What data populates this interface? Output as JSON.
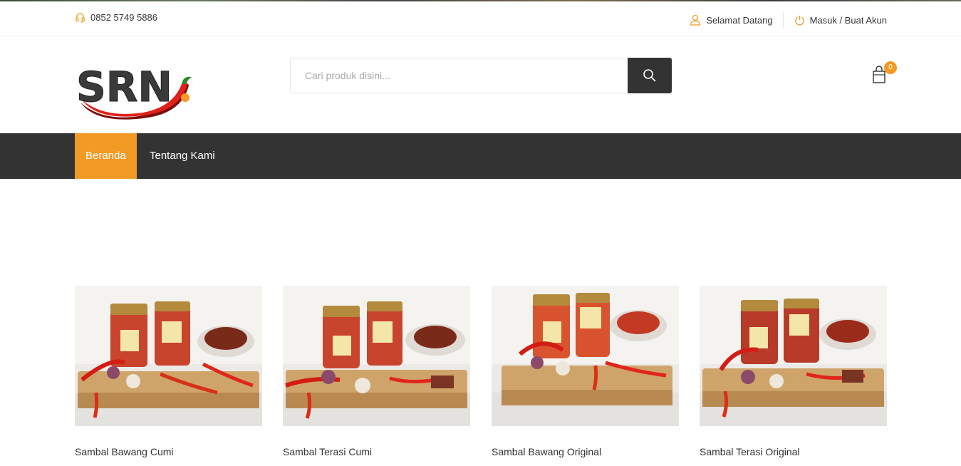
{
  "topbar": {
    "phone": "0852 5749 5886",
    "welcome": "Selamat Datang",
    "login": "Masuk / Buat Akun"
  },
  "brand": {
    "logo_text": "SRN",
    "accent_color": "#f29a24",
    "chili_color": "#e0201a"
  },
  "search": {
    "placeholder": "Cari produk disini..."
  },
  "cart": {
    "count": "0"
  },
  "nav": {
    "items": [
      {
        "label": "Beranda",
        "active": true
      },
      {
        "label": "Tentang Kami",
        "active": false
      }
    ]
  },
  "products": [
    {
      "name": "Sambal Bawang Cumi",
      "jar_fill": "#c8442c",
      "bowl_fill": "#7a2a18"
    },
    {
      "name": "Sambal Terasi Cumi",
      "jar_fill": "#c8442c",
      "bowl_fill": "#7a2a18"
    },
    {
      "name": "Sambal Bawang Original",
      "jar_fill": "#d9532e",
      "bowl_fill": "#c23a24"
    },
    {
      "name": "Sambal Terasi Original",
      "jar_fill": "#b83a28",
      "bowl_fill": "#9b2c1c"
    }
  ]
}
